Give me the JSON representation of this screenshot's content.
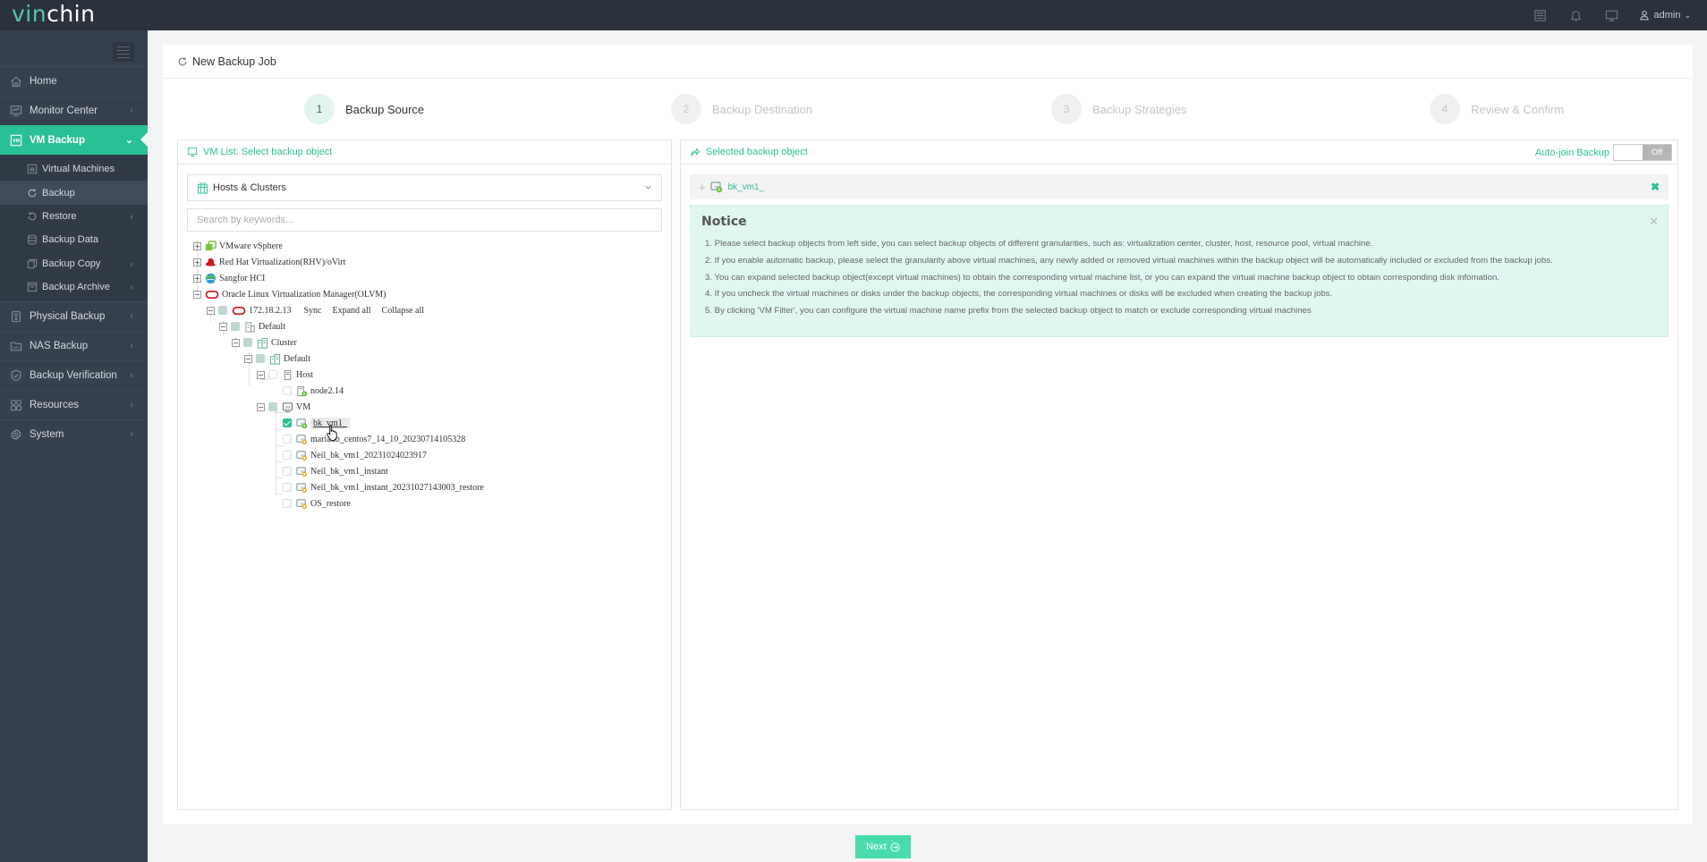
{
  "app": {
    "logo_part1": "vin",
    "logo_part2": "chin",
    "user": "admin"
  },
  "topbar_icons": [
    "list-icon",
    "bell-icon",
    "monitor-icon",
    "user-icon"
  ],
  "sidebar": {
    "items": [
      {
        "label": "Home",
        "icon": "home-icon",
        "has_arrow": false
      },
      {
        "label": "Monitor Center",
        "icon": "monitor-icon",
        "has_arrow": true
      },
      {
        "label": "VM Backup",
        "icon": "vm-icon",
        "has_arrow": true,
        "active": true
      },
      {
        "label": "Physical Backup",
        "icon": "server-icon",
        "has_arrow": true
      },
      {
        "label": "NAS Backup",
        "icon": "nas-icon",
        "has_arrow": true
      },
      {
        "label": "Backup Verification",
        "icon": "shield-icon",
        "has_arrow": true
      },
      {
        "label": "Resources",
        "icon": "grid-icon",
        "has_arrow": true
      },
      {
        "label": "System",
        "icon": "gear-icon",
        "has_arrow": true
      }
    ],
    "sub_items": [
      {
        "label": "Virtual Machines",
        "icon": "vm-list-icon",
        "has_arrow": false
      },
      {
        "label": "Backup",
        "icon": "refresh-icon",
        "has_arrow": false,
        "current": true
      },
      {
        "label": "Restore",
        "icon": "restore-icon",
        "has_arrow": true
      },
      {
        "label": "Backup Data",
        "icon": "database-icon",
        "has_arrow": false
      },
      {
        "label": "Backup Copy",
        "icon": "copy-icon",
        "has_arrow": true
      },
      {
        "label": "Backup Archive",
        "icon": "archive-icon",
        "has_arrow": true
      }
    ]
  },
  "page": {
    "title": "New Backup Job"
  },
  "steps": [
    {
      "num": "1",
      "label": "Backup Source",
      "active": true
    },
    {
      "num": "2",
      "label": "Backup Destination",
      "active": false
    },
    {
      "num": "3",
      "label": "Backup Strategies",
      "active": false
    },
    {
      "num": "4",
      "label": "Review & Confirm",
      "active": false
    }
  ],
  "left_panel": {
    "title": "VM List: Select backup object",
    "view_select": "Hosts & Clusters",
    "search_placeholder": "Search by keywords...",
    "tree": {
      "platforms": [
        "VMware vSphere",
        "Red Hat Virtualization(RHV)/oVirt",
        "Sangfor HCI",
        "Oracle Linux Virtualization Manager(OLVM)"
      ],
      "host_ip": "172.18.2.13",
      "actions": [
        "Sync",
        "Expand all",
        "Collapse all"
      ],
      "datacenter": "Default",
      "cluster_group": "Cluster",
      "cluster": "Default",
      "host_group": "Host",
      "host": "node2.14",
      "vm_group": "VM",
      "vms": [
        {
          "name": "bk_vm1_",
          "checked": true
        },
        {
          "name": "mariadb_centos7_14_10_20230714105328",
          "checked": false
        },
        {
          "name": "Neil_bk_vm1_20231024023917",
          "checked": false
        },
        {
          "name": "Neil_bk_vm1_instant",
          "checked": false
        },
        {
          "name": "Neil_bk_vm1_instant_20231027143003_restore",
          "checked": false
        },
        {
          "name": "OS_restore",
          "checked": false
        }
      ]
    }
  },
  "right_panel": {
    "title": "Selected backup object",
    "auto_join_label": "Auto-join Backup",
    "auto_join_state": "Off",
    "selected": [
      {
        "name": "bk_vm1_"
      }
    ],
    "notice": {
      "title": "Notice",
      "items": [
        "1. Please select backup objects from left side, you can select backup objects of different granularities, such as: virtualization center, cluster, host, resource pool, virtual machine.",
        "2. If you enable automatic backup, please select the granularity above virtual machines, any newly added or removed virtual machines within the backup object will be automatically included or excluded from the backup jobs.",
        "3. You can expand selected backup object(except virtual machines) to obtain the corresponding virtual machine list, or you can expand the virtual machine backup object to obtain corresponding disk infomation.",
        "4. If you uncheck the virtual machines or disks under the backup objects, the corresponding virtual machines or disks will be excluded when creating the backup jobs.",
        "5. By clicking 'VM Filter', you can configure the virtual machine name prefix from the selected backup object to match or exclude corresponding virtual machines"
      ]
    }
  },
  "footer": {
    "next_label": "Next"
  },
  "colors": {
    "accent": "#2bbf96",
    "sidebar_bg": "#364150",
    "topbar_bg": "#2b323d",
    "notice_bg": "#e0f7f1",
    "next_button": "#48dcae"
  }
}
